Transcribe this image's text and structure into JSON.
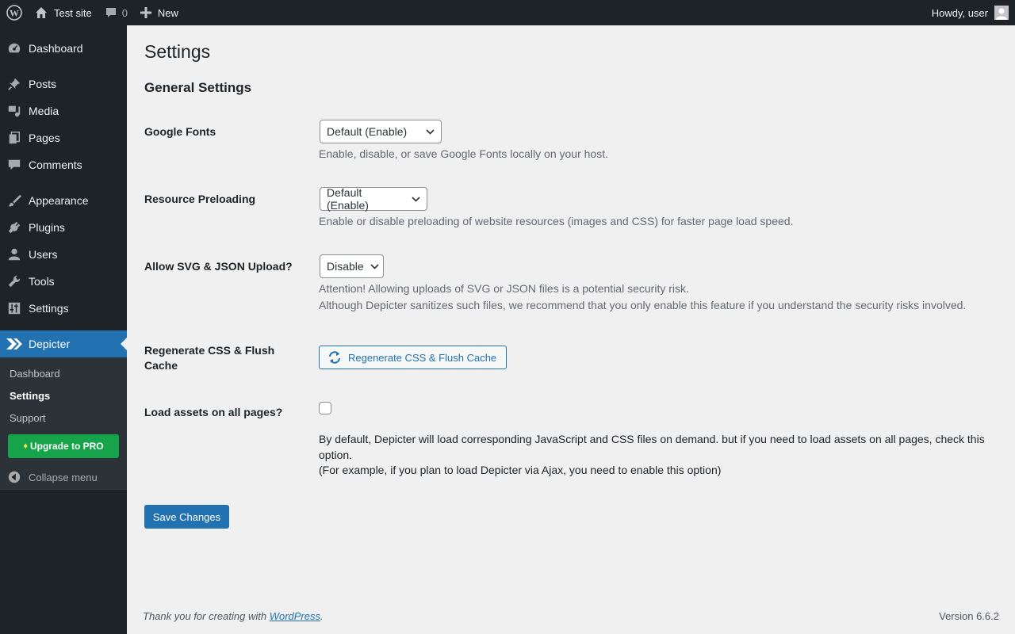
{
  "adminbar": {
    "site_name": "Test site",
    "comments_count": "0",
    "new_label": "New",
    "greeting": "Howdy, user"
  },
  "sidebar": {
    "items": [
      {
        "label": "Dashboard",
        "icon": "dashboard-icon"
      },
      {
        "label": "Posts",
        "icon": "pin-icon"
      },
      {
        "label": "Media",
        "icon": "media-icon"
      },
      {
        "label": "Pages",
        "icon": "pages-icon"
      },
      {
        "label": "Comments",
        "icon": "comment-icon"
      },
      {
        "label": "Appearance",
        "icon": "brush-icon"
      },
      {
        "label": "Plugins",
        "icon": "plug-icon"
      },
      {
        "label": "Users",
        "icon": "user-icon"
      },
      {
        "label": "Tools",
        "icon": "wrench-icon"
      },
      {
        "label": "Settings",
        "icon": "sliders-icon"
      },
      {
        "label": "Depicter",
        "icon": "depicter-icon",
        "current": true
      }
    ],
    "submenu": [
      "Dashboard",
      "Settings",
      "Support"
    ],
    "upgrade_label": "Upgrade to PRO",
    "collapse_label": "Collapse menu"
  },
  "page": {
    "title": "Settings",
    "section_title": "General Settings"
  },
  "settings": {
    "google_fonts": {
      "label": "Google Fonts",
      "value": "Default (Enable)",
      "description": "Enable, disable, or save Google Fonts locally on your host."
    },
    "preloading": {
      "label": "Resource Preloading",
      "value": "Default (Enable)",
      "description": "Enable or disable preloading of website resources (images and CSS) for faster page load speed."
    },
    "svg_upload": {
      "label": "Allow SVG & JSON Upload?",
      "value": "Disable",
      "description_1": "Attention! Allowing uploads of SVG or JSON files is a potential security risk.",
      "description_2": "Although Depicter sanitizes such files, we recommend that you only enable this feature if you understand the security risks involved."
    },
    "regenerate": {
      "label": "Regenerate CSS & Flush Cache",
      "button": "Regenerate CSS & Flush Cache"
    },
    "load_assets": {
      "label": "Load assets on all pages?",
      "checked": false,
      "description_1": "By default, Depicter will load corresponding JavaScript and CSS files on demand. but if you need to load assets on all pages, check this option.",
      "description_2": "(For example, if you plan to load Depicter via Ajax, you need to enable this option)"
    },
    "save_label": "Save Changes"
  },
  "footer": {
    "thanks_prefix": "Thank you for creating with ",
    "link_text": "WordPress",
    "thanks_suffix": ".",
    "version": "Version 6.6.2"
  },
  "colors": {
    "admin_bg": "#1d2327",
    "accent": "#2271b1",
    "upgrade": "#16a34a"
  }
}
